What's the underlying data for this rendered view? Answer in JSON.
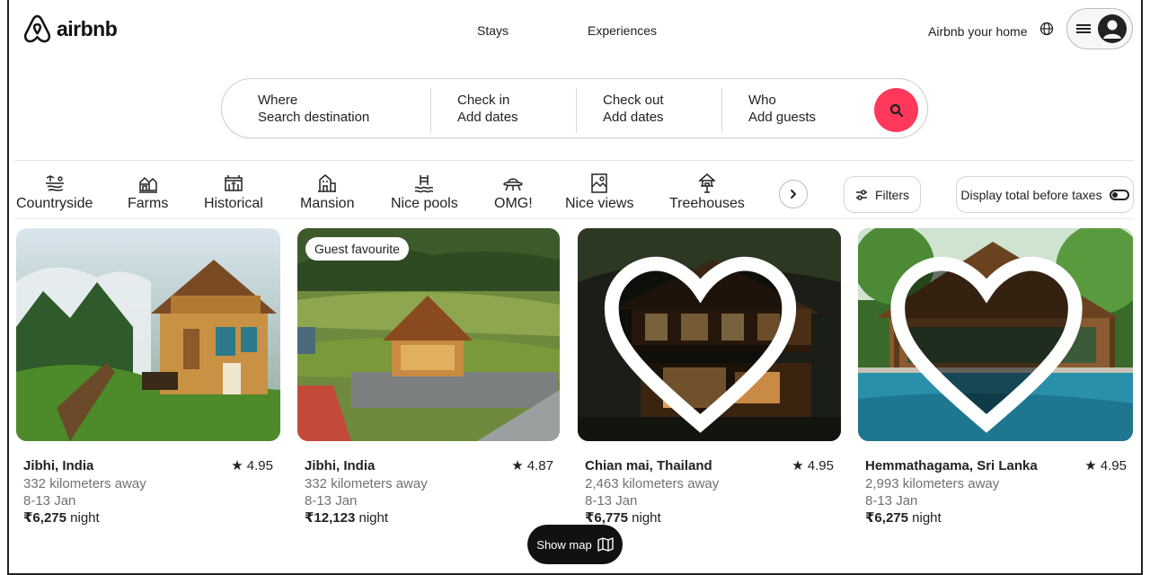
{
  "header": {
    "logo_text": "airbnb",
    "nav": [
      "Stays",
      "Experiences"
    ],
    "host_link": "Airbnb your home"
  },
  "search": {
    "where_label": "Where",
    "where_value": "Search destination",
    "checkin_label": "Check in",
    "checkin_value": "Add dates",
    "checkout_label": "Check out",
    "checkout_value": "Add dates",
    "who_label": "Who",
    "who_value": "Add guests"
  },
  "categories": [
    {
      "label": "Countryside",
      "icon": "countryside-icon"
    },
    {
      "label": "Farms",
      "icon": "farm-icon"
    },
    {
      "label": "Historical",
      "icon": "historical-icon"
    },
    {
      "label": "Mansion",
      "icon": "mansion-icon"
    },
    {
      "label": "Nice pools",
      "icon": "pool-icon"
    },
    {
      "label": "OMG!",
      "icon": "ufo-icon"
    },
    {
      "label": "Nice views",
      "icon": "views-icon"
    },
    {
      "label": "Treehouses",
      "icon": "treehouse-icon"
    }
  ],
  "filters_label": "Filters",
  "tax_toggle_label": "Display total before taxes",
  "listings": [
    {
      "title": "Jibhi, India",
      "rating": "★ 4.95",
      "distance": "332 kilometers away",
      "dates": "8-13 Jan",
      "price": "₹6,275",
      "price_unit": " night",
      "badge": ""
    },
    {
      "title": "Jibhi, India",
      "rating": "★ 4.87",
      "distance": "332 kilometers away",
      "dates": "8-13 Jan",
      "price": "₹12,123",
      "price_unit": " night",
      "badge": "Guest favourite"
    },
    {
      "title": "Chian mai, Thailand",
      "rating": "★ 4.95",
      "distance": "2,463 kilometers away",
      "dates": "8-13 Jan",
      "price": "₹6,775",
      "price_unit": " night",
      "badge": ""
    },
    {
      "title": "Hemmathagama, Sri Lanka",
      "rating": "★ 4.95",
      "distance": "2,993 kilometers away",
      "dates": "8-13 Jan",
      "price": "₹6,275",
      "price_unit": " night",
      "badge": ""
    }
  ],
  "show_map_label": "Show map",
  "colors": {
    "brand": "#ff385c",
    "text": "#222222",
    "muted": "#717171"
  }
}
